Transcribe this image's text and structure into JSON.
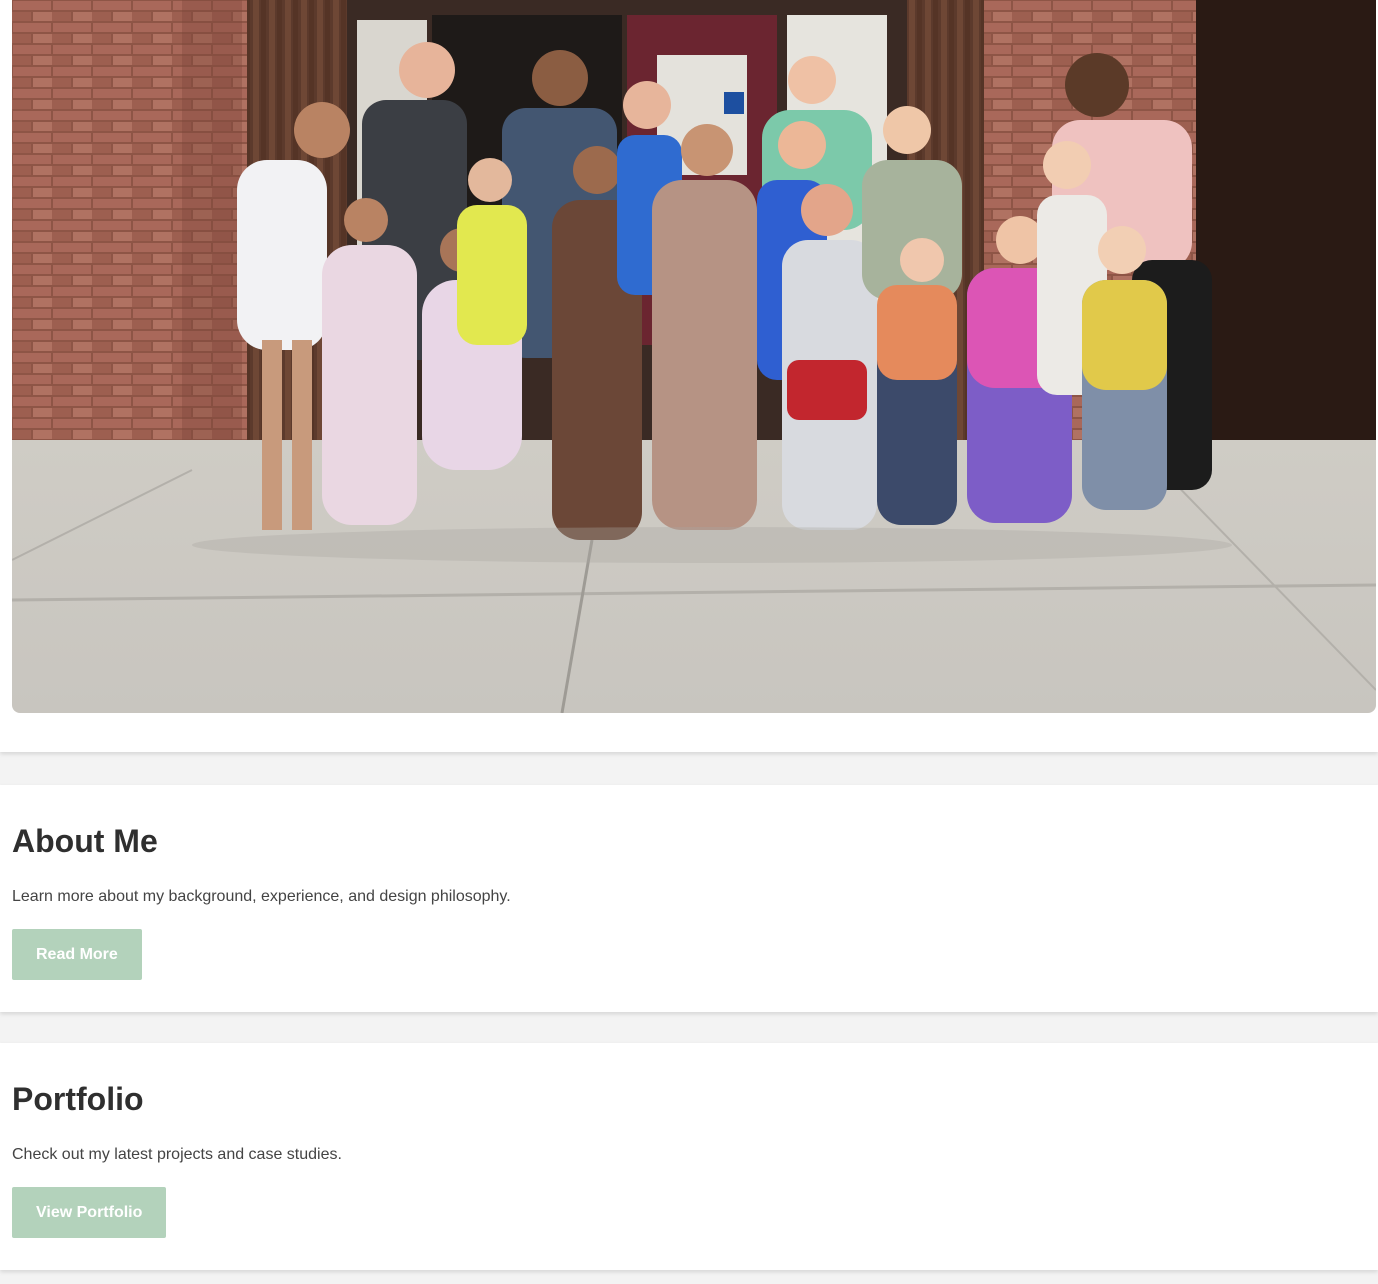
{
  "hero": {
    "photo_subject": "group-photo"
  },
  "about": {
    "title": "About Me",
    "description": "Learn more about my background, experience, and design philosophy.",
    "button_label": "Read More"
  },
  "portfolio": {
    "title": "Portfolio",
    "description": "Check out my latest projects and case studies.",
    "button_label": "View Portfolio"
  },
  "colors": {
    "accent": "#b3d2bb",
    "heading": "#2f2f2f",
    "body_text": "#444444",
    "page_background": "#f3f3f3"
  }
}
